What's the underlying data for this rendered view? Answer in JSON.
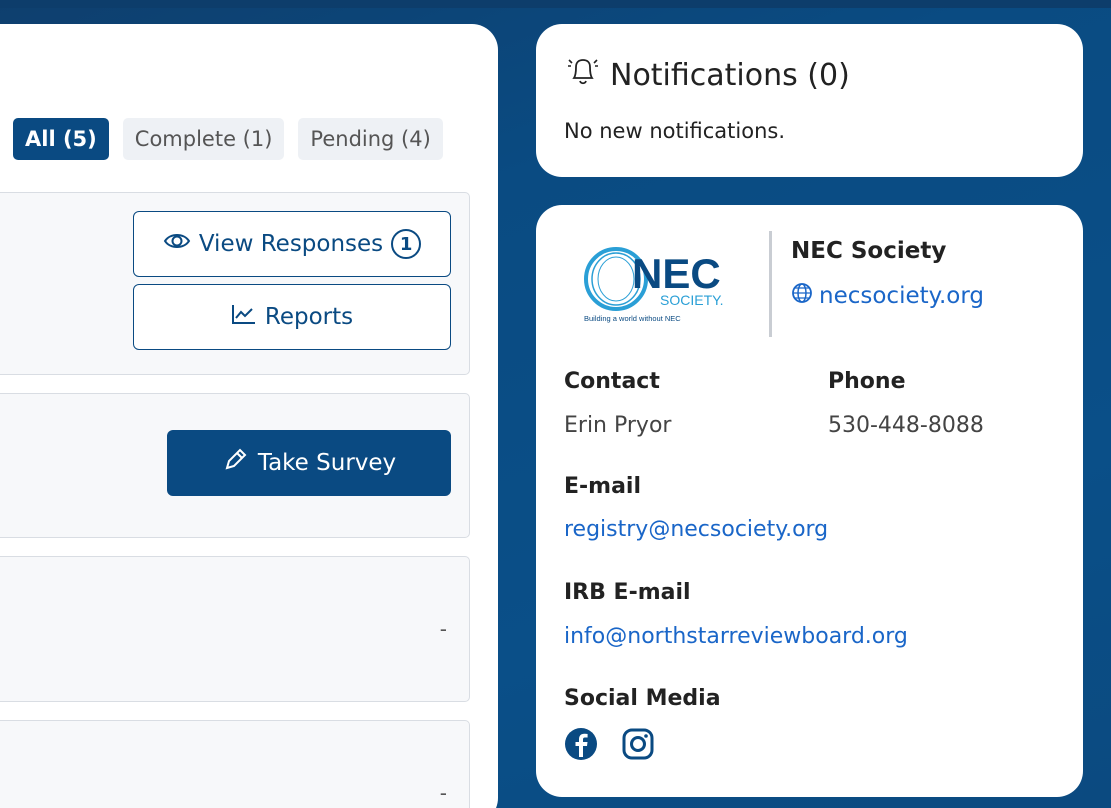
{
  "filters": {
    "all": "All (5)",
    "complete": "Complete (1)",
    "pending": "Pending (4)"
  },
  "survey_cards": {
    "view_responses_label": "View Responses",
    "view_responses_count": "1",
    "reports_label": "Reports",
    "take_survey_label": "Take Survey",
    "dash": "-"
  },
  "notifications": {
    "title": "Notifications (0)",
    "empty_text": "No new notifications."
  },
  "organization": {
    "logo_text": "NEC",
    "logo_sub": "SOCIETY.",
    "logo_tagline": "Building a world without NEC",
    "name": "NEC Society",
    "website": "necsociety.org",
    "contact_label": "Contact",
    "contact_value": "Erin Pryor",
    "phone_label": "Phone",
    "phone_value": "530-448-8088",
    "email_label": "E-mail",
    "email_value": "registry@necsociety.org",
    "irb_label": "IRB E-mail",
    "irb_value": "info@northstarreviewboard.org",
    "social_label": "Social Media"
  },
  "colors": {
    "brand": "#0a4a82",
    "link": "#1a66c8",
    "logo_blue": "#2a9fd6"
  },
  "icons": [
    "bell-icon",
    "eye-icon",
    "chart-line-icon",
    "pencil-icon",
    "globe-icon",
    "facebook-icon",
    "instagram-icon"
  ]
}
